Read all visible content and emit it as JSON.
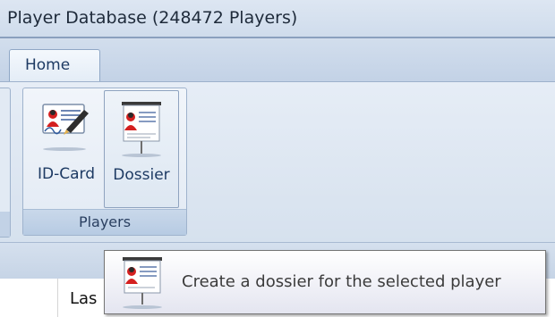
{
  "window": {
    "title": "Player Database (248472 Players)"
  },
  "ribbon": {
    "tabs": [
      {
        "label": "Home",
        "active": true
      }
    ],
    "group": {
      "caption": "Players",
      "buttons": [
        {
          "label": "ID-Card",
          "icon": "id-card-icon"
        },
        {
          "label": "Dossier",
          "icon": "dossier-presentation-icon",
          "hovered": true
        }
      ]
    }
  },
  "table": {
    "column_header_partial": "Las"
  },
  "tooltip": {
    "text": "Create a dossier for the selected player",
    "icon": "dossier-presentation-icon"
  },
  "colors": {
    "accent": "#1d3a63",
    "ribbon": "#dde6f2",
    "highlight_red": "#cc2020"
  }
}
